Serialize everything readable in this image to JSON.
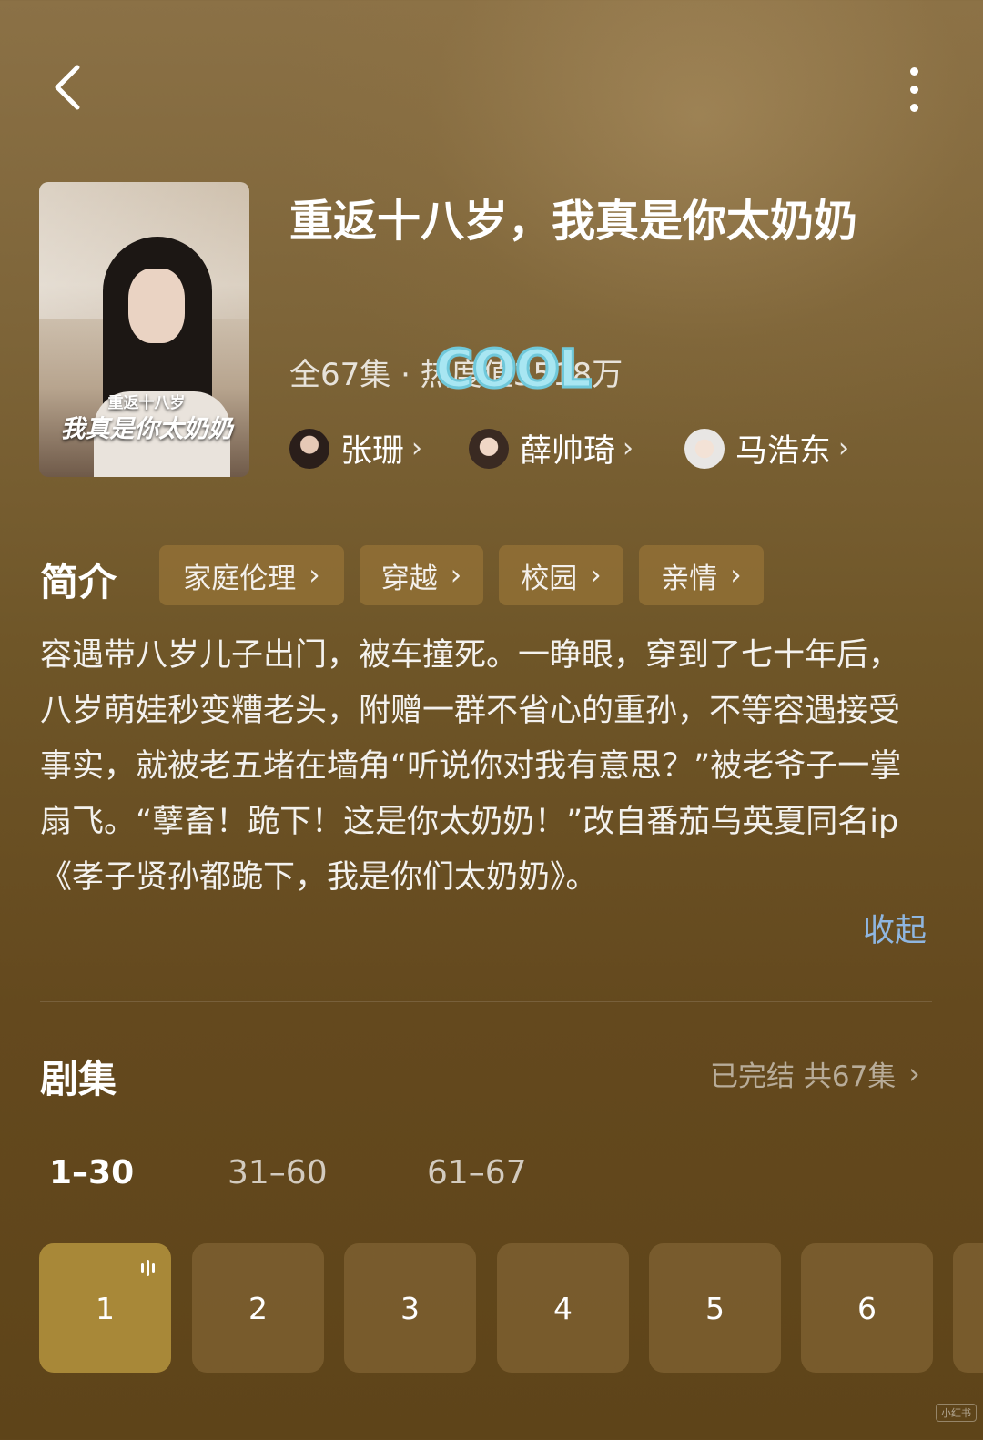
{
  "header": {
    "back_icon": "chevron-left-icon",
    "more_icon": "vertical-dots-icon"
  },
  "drama": {
    "title": "重返十八岁，我真是你太奶奶",
    "meta": "全67集 · 热度值3518万",
    "sticker_text": "COOL",
    "poster": {
      "subtitle": "重返十八岁",
      "title": "我真是你太奶奶"
    },
    "cast": [
      {
        "name": "张珊",
        "chevron": "›"
      },
      {
        "name": "薛帅琦",
        "chevron": "›"
      },
      {
        "name": "马浩东",
        "chevron": "›"
      }
    ]
  },
  "intro": {
    "heading": "简介",
    "tags": [
      {
        "label": "家庭伦理",
        "chevron": "›"
      },
      {
        "label": "穿越",
        "chevron": "›"
      },
      {
        "label": "校园",
        "chevron": "›"
      },
      {
        "label": "亲情",
        "chevron": "›"
      }
    ],
    "description": "容遇带八岁儿子出门，被车撞死。一睁眼，穿到了七十年后，八岁萌娃秒变糟老头，附赠一群不省心的重孙，不等容遇接受事实，就被老五堵在墙角“听说你对我有意思？”被老爷子一掌扇飞。“孽畜！跪下！这是你太奶奶！”改自番茄乌英夏同名ip《孝子贤孙都跪下，我是你们太奶奶》。",
    "collapse_label": "收起"
  },
  "episodes": {
    "heading": "剧集",
    "status": "已完结 共67集",
    "status_chevron": "›",
    "ranges": [
      "1–30",
      "31–60",
      "61–67"
    ],
    "active_range": "1–30",
    "items": [
      "1",
      "2",
      "3",
      "4",
      "5",
      "6"
    ],
    "playing": "1"
  },
  "colors": {
    "accent": "#a88838",
    "link": "#8fb6e0",
    "background": "#6f5628"
  },
  "watermark": "小红书"
}
